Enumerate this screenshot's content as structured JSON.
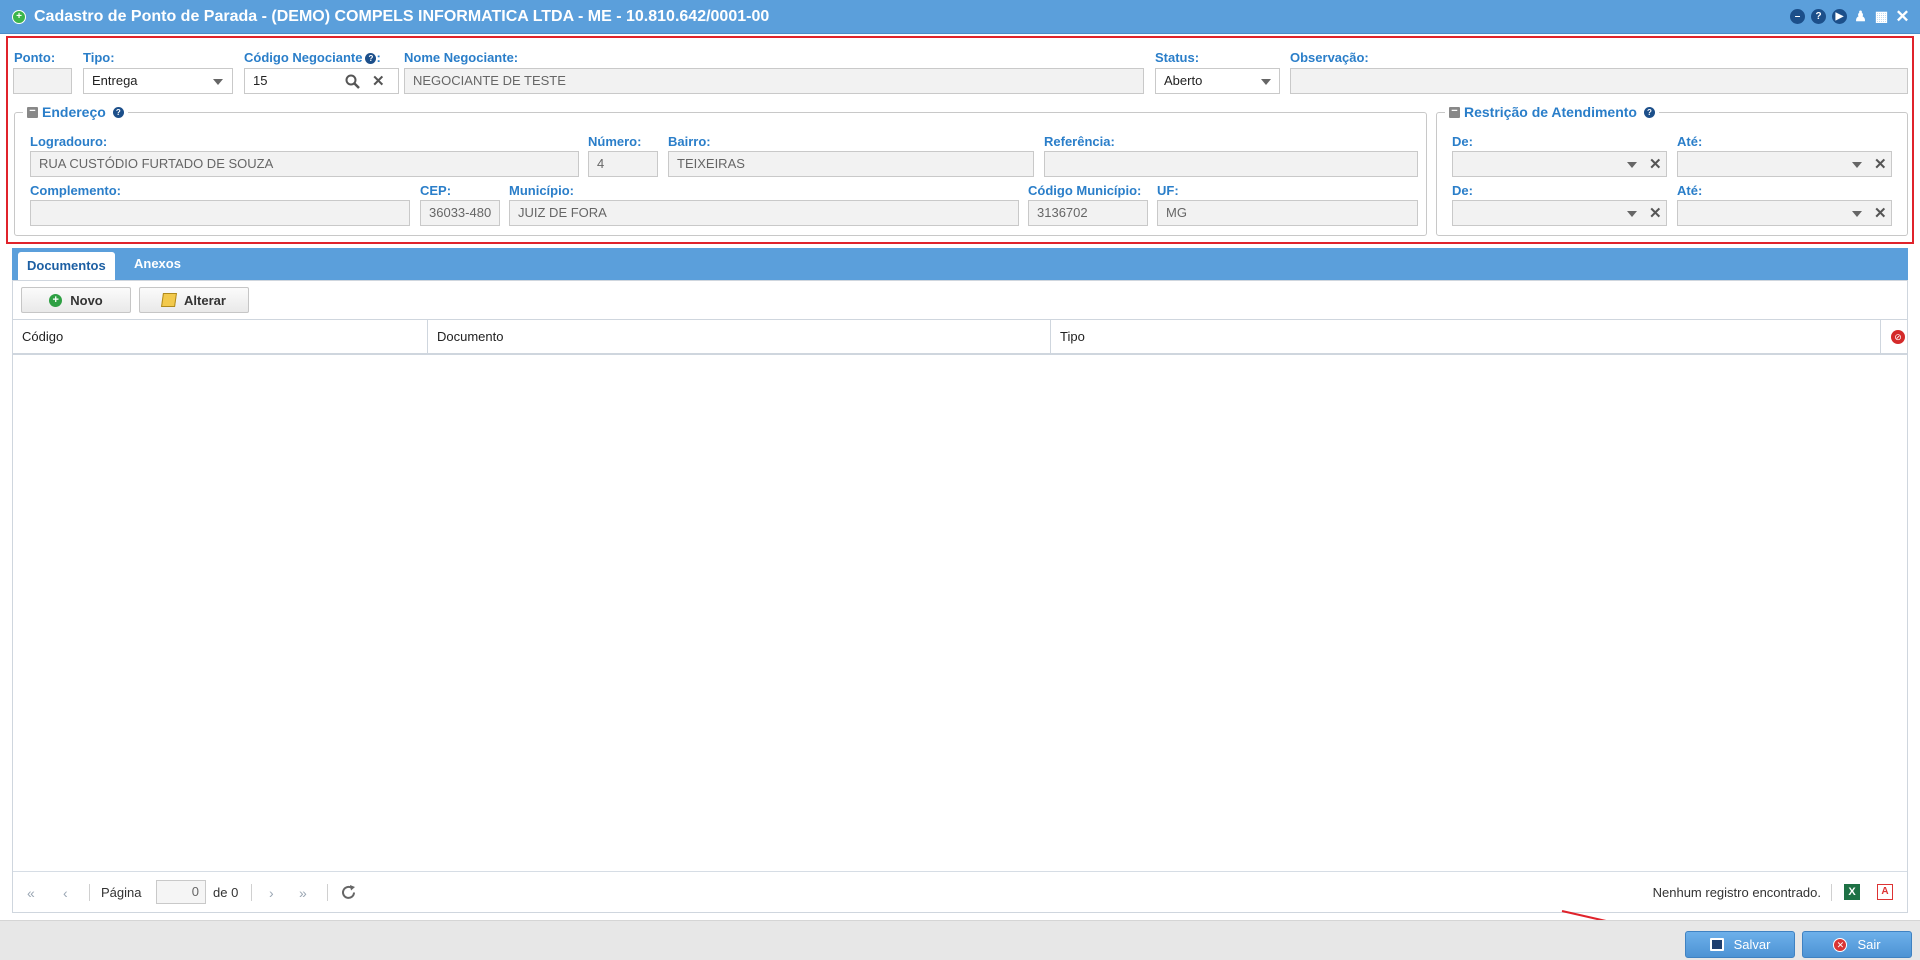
{
  "window": {
    "title": "Cadastro de Ponto de Parada - (DEMO) COMPELS INFORMATICA LTDA - ME - 10.810.642/0001-00"
  },
  "form": {
    "ponto": {
      "label": "Ponto:",
      "value": ""
    },
    "tipo": {
      "label": "Tipo:",
      "value": "Entrega"
    },
    "codigo_negociante": {
      "label": "Código Negociante",
      "suffix": ":",
      "value": "15"
    },
    "nome_negociante": {
      "label": "Nome Negociante:",
      "value": "NEGOCIANTE DE TESTE"
    },
    "status": {
      "label": "Status:",
      "value": "Aberto"
    },
    "observacao": {
      "label": "Observação:",
      "value": ""
    }
  },
  "endereco": {
    "legend": "Endereço",
    "logradouro": {
      "label": "Logradouro:",
      "value": "RUA CUSTÓDIO FURTADO DE SOUZA"
    },
    "numero": {
      "label": "Número:",
      "value": "4"
    },
    "bairro": {
      "label": "Bairro:",
      "value": "TEIXEIRAS"
    },
    "referencia": {
      "label": "Referência:",
      "value": ""
    },
    "complemento": {
      "label": "Complemento:",
      "value": ""
    },
    "cep": {
      "label": "CEP:",
      "value": "36033-480"
    },
    "municipio": {
      "label": "Município:",
      "value": "JUIZ DE FORA"
    },
    "codigo_municipio": {
      "label": "Código Município:",
      "value": "3136702"
    },
    "uf": {
      "label": "UF:",
      "value": "MG"
    }
  },
  "restricao": {
    "legend": "Restrição de Atendimento",
    "de_label": "De:",
    "ate_label": "Até:"
  },
  "tabs": [
    {
      "label": "Documentos",
      "active": true
    },
    {
      "label": "Anexos",
      "active": false
    }
  ],
  "toolbar": {
    "novo": "Novo",
    "alterar": "Alterar"
  },
  "grid": {
    "columns": [
      "Código",
      "Documento",
      "Tipo"
    ]
  },
  "pager": {
    "page_label": "Página",
    "page_value": "0",
    "of_label": "de 0",
    "status": "Nenhum registro encontrado."
  },
  "footer": {
    "salvar": "Salvar",
    "sair": "Sair"
  },
  "colors": {
    "accent": "#5b9fdb",
    "label": "#2a7ec9",
    "highlight": "#e0232b"
  }
}
